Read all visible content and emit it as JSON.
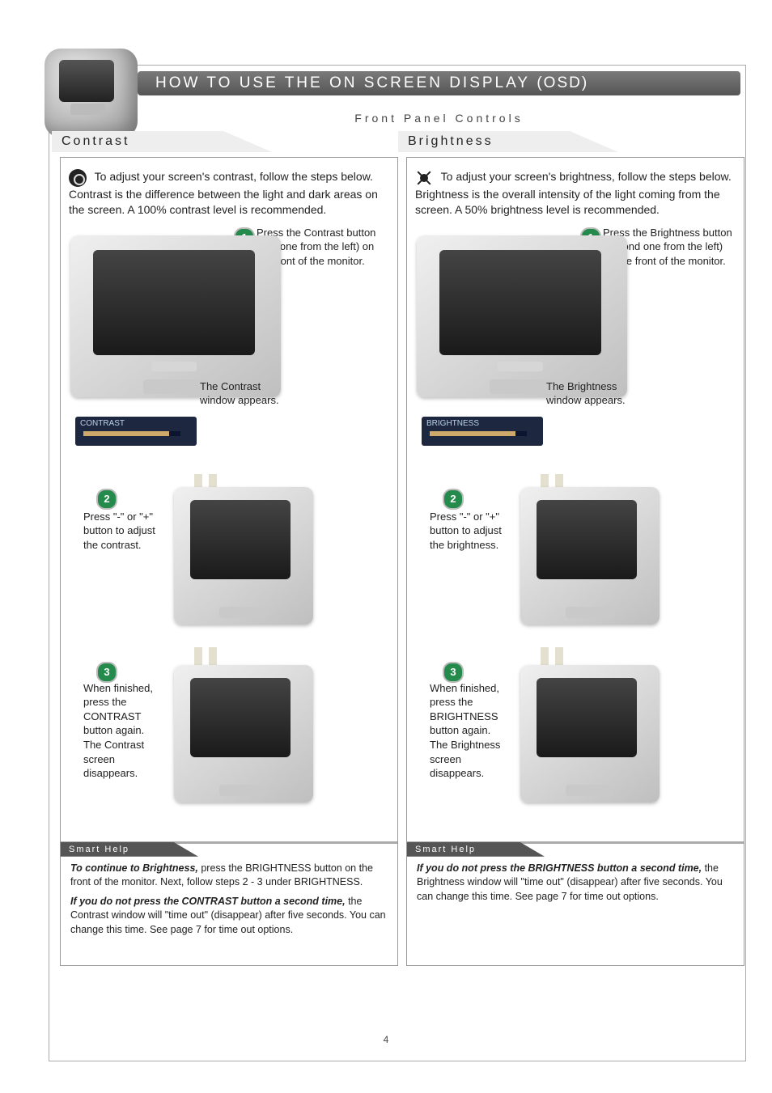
{
  "header": {
    "title_left": "How to Use the On Screen Display",
    "title_right": "(OSD)",
    "subtitle": "Front Panel Controls"
  },
  "contrast": {
    "tab": "Contrast",
    "intro": "To adjust your screen's contrast, follow the steps below. Contrast is the difference between the light and dark areas on the screen. A 100% contrast level is recommended.",
    "step1_badge": "1",
    "step1_text": "Press the Contrast button (first one from the left) on the front of the monitor.",
    "step1_caption": "The Contrast window appears.",
    "osd_label": "CONTRAST",
    "step2_badge": "2",
    "step2_text": "Press \"-\" or \"+\" button to adjust the contrast.",
    "step3_badge": "3",
    "step3_text": "When finished, press the CONTRAST button again. The Contrast screen disappears.",
    "help_tab": "Smart Help",
    "help1_lead": "To continue to Brightness,",
    "help1_rest": " press the BRIGHTNESS button on the front of the monitor. Next, follow steps 2 - 3 under BRIGHTNESS.",
    "help2_lead": "If you do not press the CONTRAST button a second time,",
    "help2_rest": " the Contrast window will \"time out\" (disappear) after five seconds. You can change this time. See page 7 for time out options."
  },
  "brightness": {
    "tab": "Brightness",
    "intro": "To adjust your screen's brightness, follow the steps below. Brightness is the overall intensity of the light coming from the screen. A 50% brightness level is recommended.",
    "step1_badge": "1",
    "step1_text": "Press the Brightness button (second one from the left) on the front of the monitor.",
    "step1_caption": "The Brightness window appears.",
    "osd_label": "BRIGHTNESS",
    "step2_badge": "2",
    "step2_text": "Press \"-\" or \"+\" button to adjust the brightness.",
    "step3_badge": "3",
    "step3_text": "When finished, press the BRIGHTNESS button again. The Brightness screen disappears.",
    "help_tab": "Smart Help",
    "help_lead": "If you do not press the BRIGHTNESS button a second time,",
    "help_rest": " the Brightness window will \"time out\" (disappear) after five seconds. You can change this time. See page 7 for time out options."
  },
  "page_number": "4",
  "osd_contrast_fill_pct": 88,
  "osd_brightness_fill_pct": 88
}
